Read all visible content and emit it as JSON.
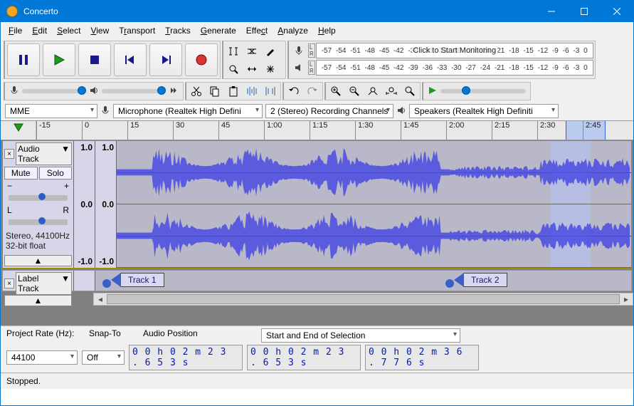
{
  "window": {
    "title": "Concerto"
  },
  "menu": [
    "File",
    "Edit",
    "Select",
    "View",
    "Transport",
    "Tracks",
    "Generate",
    "Effect",
    "Analyze",
    "Help"
  ],
  "meter_ticks": [
    "-57",
    "-54",
    "-51",
    "-48",
    "-45",
    "-42",
    "-39",
    "-36",
    "-33",
    "-30",
    "-27",
    "-24",
    "-21",
    "-18",
    "-15",
    "-12",
    "-9",
    "-6",
    "-3",
    "0"
  ],
  "monitor_text": "Click to Start Monitoring",
  "device": {
    "host": "MME",
    "input": "Microphone (Realtek High Defini",
    "channels": "2 (Stereo) Recording Channels",
    "output": "Speakers (Realtek High Definiti"
  },
  "timeline": [
    "-15",
    "0",
    "15",
    "30",
    "45",
    "1:00",
    "1:15",
    "1:30",
    "1:45",
    "2:00",
    "2:15",
    "2:30",
    "2:45"
  ],
  "track": {
    "name": "Audio Track",
    "mute": "Mute",
    "solo": "Solo",
    "info1": "Stereo, 44100Hz",
    "info2": "32-bit float",
    "scale": [
      "1.0",
      "0.0",
      "-1.0"
    ]
  },
  "labeltrack": {
    "name": "Label Track",
    "labels": [
      "Track 1",
      "Track 2"
    ]
  },
  "bottom": {
    "project_rate_label": "Project Rate (Hz):",
    "project_rate": "44100",
    "snap_label": "Snap-To",
    "snap": "Off",
    "audio_pos_label": "Audio Position",
    "audio_pos": "0 0 h 0 2 m 2 3 . 6 5 3 s",
    "sel_label": "Start and End of Selection",
    "sel_start": "0 0 h 0 2 m 2 3 . 6 5 3 s",
    "sel_end": "0 0 h 0 2 m 3 6 . 7 7 6 s"
  },
  "status": "Stopped."
}
